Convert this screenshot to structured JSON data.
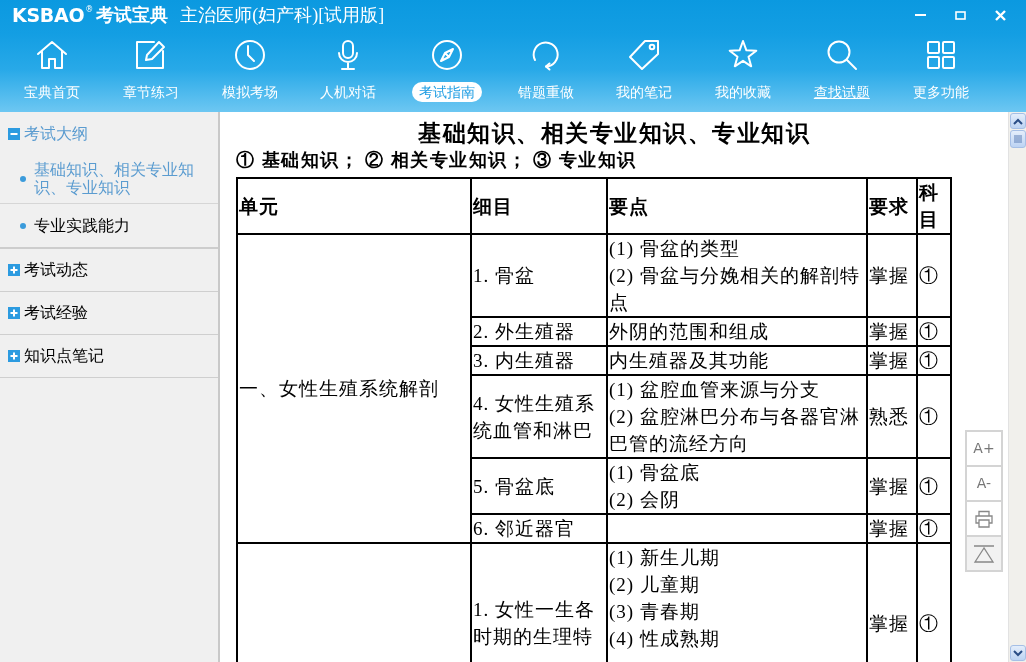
{
  "window": {
    "logo": "KSBAO",
    "logo_mark": "®",
    "logo_name": "考试宝典",
    "title": "主治医师(妇产科)[试用版]"
  },
  "toolbar": [
    {
      "label": "宝典首页",
      "selected": false,
      "hovered": false
    },
    {
      "label": "章节练习",
      "selected": false,
      "hovered": false
    },
    {
      "label": "模拟考场",
      "selected": false,
      "hovered": false
    },
    {
      "label": "人机对话",
      "selected": false,
      "hovered": false
    },
    {
      "label": "考试指南",
      "selected": true,
      "hovered": false
    },
    {
      "label": "错题重做",
      "selected": false,
      "hovered": false
    },
    {
      "label": "我的笔记",
      "selected": false,
      "hovered": false
    },
    {
      "label": "我的收藏",
      "selected": false,
      "hovered": false
    },
    {
      "label": "查找试题",
      "selected": false,
      "hovered": true
    },
    {
      "label": "更多功能",
      "selected": false,
      "hovered": false
    }
  ],
  "sidebar": [
    {
      "label": "考试大纲",
      "expanded": true,
      "children": [
        {
          "label": "基础知识、相关专业知识、专业知识",
          "selected": true
        },
        {
          "label": "专业实践能力",
          "selected": false
        }
      ]
    },
    {
      "label": "考试动态",
      "expanded": false
    },
    {
      "label": "考试经验",
      "expanded": false
    },
    {
      "label": "知识点笔记",
      "expanded": false
    }
  ],
  "document": {
    "title": "基础知识、相关专业知识、专业知识",
    "legend": "① 基础知识； ② 相关专业知识； ③ 专业知识",
    "table": {
      "columns": [
        "单元",
        "细目",
        "要点",
        "要求",
        "科目"
      ],
      "groups": [
        {
          "unit": "一、女性生殖系统解剖",
          "rows": [
            {
              "item": "1. 骨盆",
              "points": [
                "(1) 骨盆的类型",
                "(2) 骨盆与分娩相关的解剖特点"
              ],
              "requirement": "掌握",
              "subject": "①"
            },
            {
              "item": "2. 外生殖器",
              "points": [
                "外阴的范围和组成"
              ],
              "requirement": "掌握",
              "subject": "①"
            },
            {
              "item": "3. 内生殖器",
              "points": [
                "内生殖器及其功能"
              ],
              "requirement": "掌握",
              "subject": "①"
            },
            {
              "item": "4. 女性生殖系统血管和淋巴",
              "points": [
                "(1) 盆腔血管来源与分支",
                "(2) 盆腔淋巴分布与各器官淋巴管的流经方向"
              ],
              "requirement": "熟悉",
              "subject": "①"
            },
            {
              "item": "5. 骨盆底",
              "points": [
                "(1) 骨盆底",
                "(2) 会阴"
              ],
              "requirement": "掌握",
              "subject": "①"
            },
            {
              "item": "6. 邻近器官",
              "requirement": "掌握",
              "subject": "①"
            }
          ]
        },
        {
          "rows": [
            {
              "item": "1. 女性一生各时期的生理特",
              "points": [
                "(1) 新生儿期",
                "(2) 儿童期",
                "(3) 青春期",
                "(4) 性成熟期"
              ],
              "requirement": "掌握",
              "subject": "①"
            }
          ]
        }
      ]
    }
  },
  "font_buttons": [
    "A+",
    "A-"
  ]
}
